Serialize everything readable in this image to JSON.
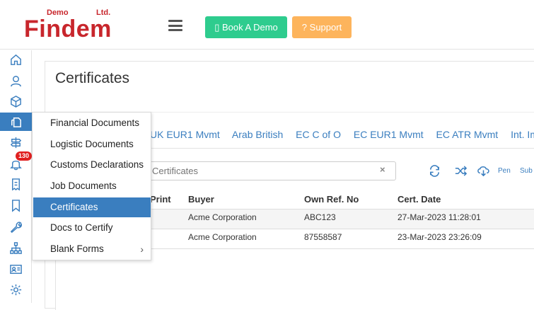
{
  "brand": {
    "name": "Findem",
    "demo": "Demo",
    "ltd": "Ltd."
  },
  "header": {
    "book_demo": "Book A Demo",
    "support": "Support"
  },
  "sidebar": {
    "badge_count": "130",
    "active_color": "#3a7ebf"
  },
  "page": {
    "title": "Certificates"
  },
  "tabs": [
    "UK EUR1 Mvmt",
    "Arab British",
    "EC C of O",
    "EC EUR1 Mvmt",
    "EC ATR Mvmt",
    "Int. Imp."
  ],
  "search": {
    "placeholder": "Certificates",
    "clear": "×"
  },
  "tools": {
    "pen": "Pen",
    "sub": "Sub"
  },
  "table": {
    "headers": {
      "print": "Print",
      "buyer": "Buyer",
      "ref": "Own Ref. No",
      "date": "Cert. Date"
    },
    "rows": [
      {
        "buyer": "Acme Corporation",
        "ref": "ABC123",
        "date": "27-Mar-2023 11:28:01"
      },
      {
        "buyer": "Acme Corporation",
        "ref": "87558587",
        "date": "23-Mar-2023 23:26:09"
      }
    ]
  },
  "menu": {
    "items": [
      "Financial Documents",
      "Logistic Documents",
      "Customs Declarations",
      "Job Documents",
      "Certificates",
      "Docs to Certify",
      "Blank Forms"
    ],
    "active": "Certificates",
    "submenu_chevron": "›"
  }
}
